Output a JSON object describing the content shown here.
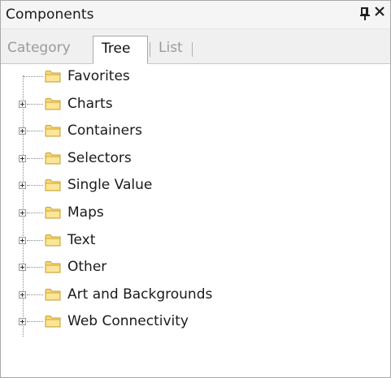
{
  "panel": {
    "title": "Components",
    "pin_glyph": "¤",
    "close_glyph": "×"
  },
  "tabs": [
    {
      "label": "Category",
      "active": false
    },
    {
      "label": "Tree",
      "active": true
    },
    {
      "label": "List",
      "active": false
    }
  ],
  "tree": {
    "items": [
      {
        "label": "Favorites",
        "expandable": false,
        "icon": "folder-icon"
      },
      {
        "label": "Charts",
        "expandable": true,
        "icon": "folder-icon"
      },
      {
        "label": "Containers",
        "expandable": true,
        "icon": "folder-icon"
      },
      {
        "label": "Selectors",
        "expandable": true,
        "icon": "folder-icon"
      },
      {
        "label": "Single Value",
        "expandable": true,
        "icon": "folder-icon"
      },
      {
        "label": "Maps",
        "expandable": true,
        "icon": "folder-icon"
      },
      {
        "label": "Text",
        "expandable": true,
        "icon": "folder-icon"
      },
      {
        "label": "Other",
        "expandable": true,
        "icon": "folder-icon"
      },
      {
        "label": "Art and Backgrounds",
        "expandable": true,
        "icon": "folder-icon"
      },
      {
        "label": "Web Connectivity",
        "expandable": true,
        "icon": "folder-icon"
      }
    ]
  },
  "colors": {
    "folder_fill": "#f7d774",
    "folder_stroke": "#c9a235",
    "active_tab_text": "#111111",
    "inactive_tab_text": "#9a9a9a"
  }
}
